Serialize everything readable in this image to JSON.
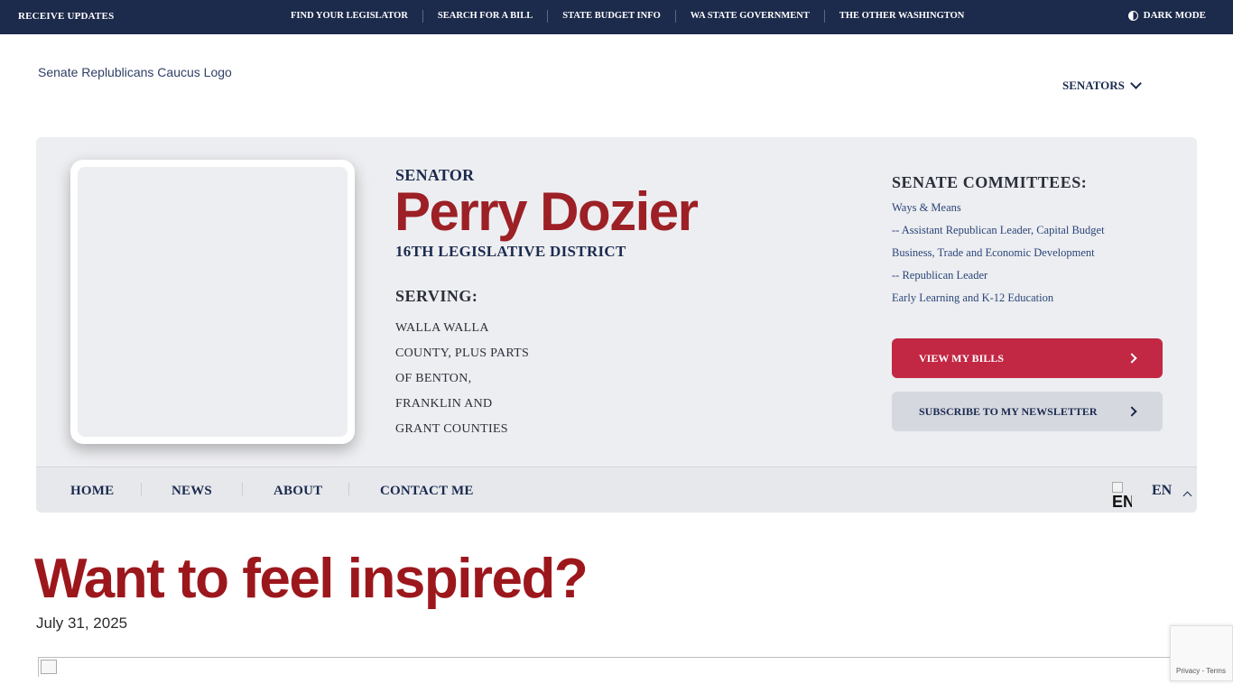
{
  "topbar": {
    "receive_updates": "RECEIVE UPDATES",
    "links": [
      "FIND YOUR LEGISLATOR",
      "SEARCH FOR A BILL",
      "STATE BUDGET INFO",
      "WA STATE GOVERNMENT",
      "THE OTHER WASHINGTON"
    ],
    "dark_mode": "DARK MODE"
  },
  "header": {
    "logo_alt": "Senate Replublicans Caucus Logo",
    "senators_menu": "SENATORS"
  },
  "profile": {
    "title_label": "SENATOR",
    "name": "Perry Dozier",
    "district": "16TH LEGISLATIVE DISTRICT",
    "serving_label": "SERVING:",
    "serving_lines": [
      "WALLA WALLA",
      "COUNTY, PLUS PARTS",
      "OF BENTON,",
      "FRANKLIN AND",
      "GRANT COUNTIES"
    ],
    "committees_label": "SENATE COMMITTEES:",
    "committees": [
      "Ways & Means",
      "-- Assistant Republican Leader, Capital Budget",
      "Business, Trade and Economic Development",
      "-- Republican Leader",
      "Early Learning and K-12 Education"
    ],
    "view_bills": "VIEW MY BILLS",
    "subscribe": "SUBSCRIBE TO MY NEWSLETTER"
  },
  "nav": {
    "items": [
      "HOME",
      "NEWS",
      "ABOUT",
      "CONTACT ME"
    ],
    "language_flag_alt": "EN",
    "language": "EN"
  },
  "article": {
    "title": "Want to feel inspired?",
    "date": "July 31, 2025"
  },
  "recaptcha": {
    "links": "Privacy - Terms"
  },
  "colors": {
    "topbar_bg": "#1c2a4b",
    "brand_red": "#9c2025",
    "button_red": "#c22844",
    "navy": "#1b2a4e",
    "card_bg": "#edeef1"
  }
}
